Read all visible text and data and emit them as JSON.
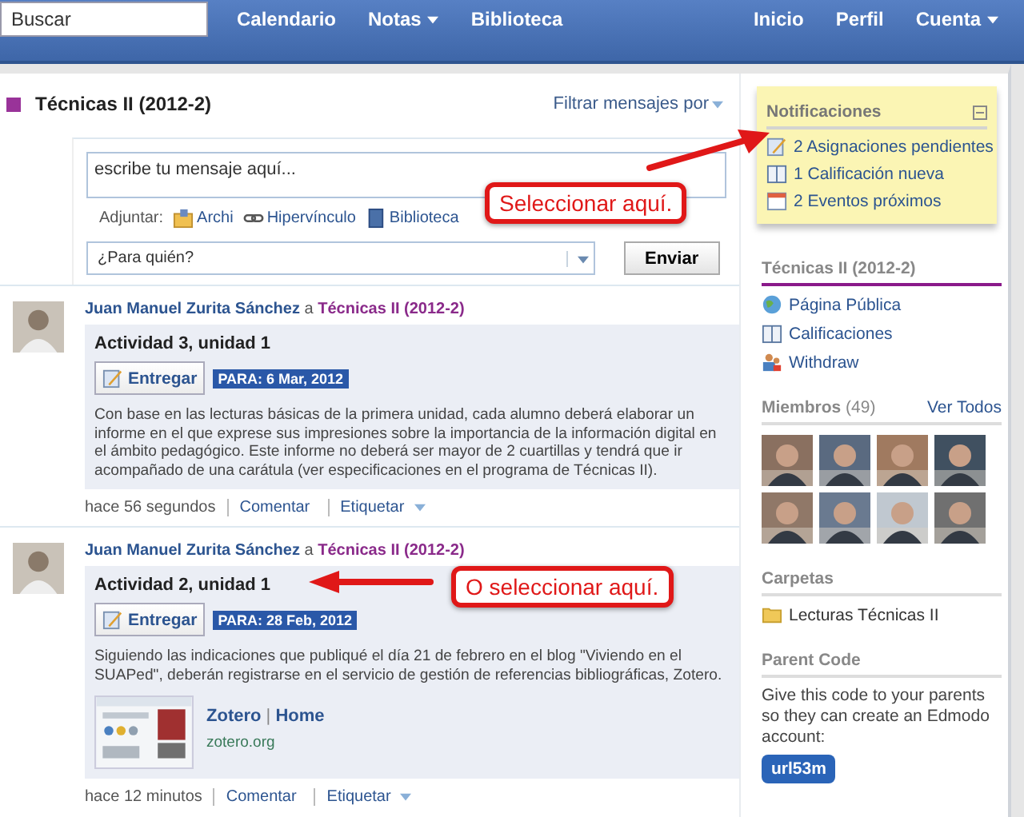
{
  "nav": {
    "search": {
      "placeholder": "Buscar"
    },
    "left_links": [
      {
        "label": "Calendario",
        "dropdown": false
      },
      {
        "label": "Notas",
        "dropdown": true
      },
      {
        "label": "Biblioteca",
        "dropdown": false
      }
    ],
    "right_links": [
      {
        "label": "Inicio",
        "dropdown": false
      },
      {
        "label": "Perfil",
        "dropdown": false
      },
      {
        "label": "Cuenta",
        "dropdown": true
      }
    ]
  },
  "group": {
    "title": "Técnicas II (2012-2)",
    "color": "#993399",
    "filter": "Filtrar mensajes por"
  },
  "composer": {
    "placeholder": "escribe tu mensaje aquí...",
    "attach_label": "Adjuntar:",
    "attachments": [
      {
        "kind": "file",
        "label": "Archi"
      },
      {
        "kind": "link",
        "label": "Hipervínculo"
      },
      {
        "kind": "library",
        "label": "Biblioteca"
      }
    ],
    "recipient": {
      "placeholder": "¿Para quién?"
    },
    "send": "Enviar"
  },
  "posts": [
    {
      "author": "Juan Manuel Zurita Sánchez",
      "connector": "a",
      "group": "Técnicas II (2012-2)",
      "title": "Actividad 3, unidad 1",
      "submit": "Entregar",
      "due": "PARA: 6 Mar, 2012",
      "body": "Con base en las lecturas básicas de la primera unidad, cada alumno deberá elaborar un informe en el que exprese sus impresiones sobre la importancia de la información digital en el ámbito pedagógico. Este informe no deberá ser mayor de 2 cuartillas y tendrá que ir acompañado de una carátula (ver especificaciones en el programa de Técnicas II).",
      "time": "hace 56 segundos",
      "actions": [
        "Comentar",
        "Etiquetar"
      ]
    },
    {
      "author": "Juan Manuel Zurita Sánchez",
      "connector": "a",
      "group": "Técnicas II (2012-2)",
      "title": "Actividad 2, unidad 1",
      "submit": "Entregar",
      "due": "PARA: 28 Feb, 2012",
      "body": "Siguiendo las indicaciones que publiqué el día 21 de febrero en el blog \"Viviendo en el SUAPed\", deberán registrarse en el servicio de gestión de referencias bibliográficas, Zotero.",
      "link": {
        "title": "Zotero",
        "separator": "|",
        "subtitle": "Home",
        "url": "zotero.org"
      },
      "time": "hace 12 minutos",
      "actions": [
        "Comentar",
        "Etiquetar"
      ]
    }
  ],
  "sidebar": {
    "notifications": {
      "title": "Notificaciones",
      "items": [
        {
          "kind": "assignment",
          "label": "2 Asignaciones pendientes"
        },
        {
          "kind": "grade",
          "label": "1 Calificación nueva"
        },
        {
          "kind": "event",
          "label": "2 Eventos próximos"
        }
      ]
    },
    "group_links": {
      "title": "Técnicas II (2012-2)",
      "items": [
        {
          "kind": "globe",
          "label": "Página Pública"
        },
        {
          "kind": "grade",
          "label": "Calificaciones"
        },
        {
          "kind": "people",
          "label": "Withdraw"
        }
      ]
    },
    "members": {
      "title": "Miembros",
      "count": "(49)",
      "view_all": "Ver Todos"
    },
    "folders": {
      "title": "Carpetas",
      "items": [
        "Lecturas Técnicas II"
      ]
    },
    "parent_code": {
      "title": "Parent Code",
      "text": "Give this code to your parents so they can create an Edmodo account:",
      "code": "url53m"
    }
  },
  "callouts": [
    {
      "label": "Seleccionar aquí."
    },
    {
      "label": "O seleccionar aquí."
    }
  ]
}
